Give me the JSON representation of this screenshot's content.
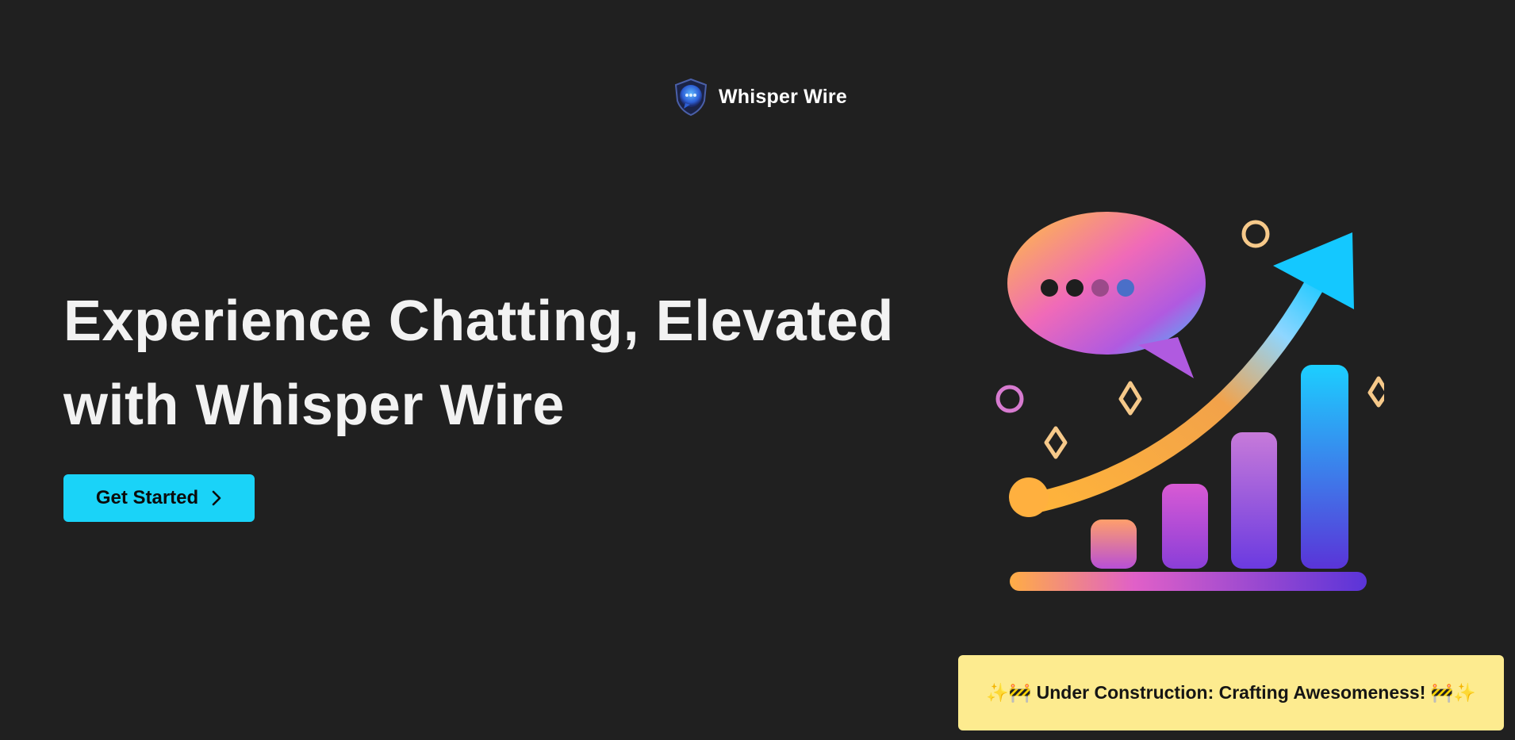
{
  "header": {
    "brand_name": "Whisper Wire",
    "logo_icon": "whisper-wire-shield-chat-logo"
  },
  "hero": {
    "title_line1": "Experience Chatting, Elevated",
    "title_line2": "with Whisper Wire",
    "cta_label": "Get Started",
    "cta_icon": "chevron-right-icon",
    "illustration": "chat-bubble-growth-chart-illustration"
  },
  "notice": {
    "text": "✨🚧 Under Construction: Crafting Awesomeness! 🚧✨"
  },
  "colors": {
    "background": "#202020",
    "accent": "#1ad3f8",
    "notice_background": "#fdeb8f",
    "text_primary": "#ffffff"
  }
}
